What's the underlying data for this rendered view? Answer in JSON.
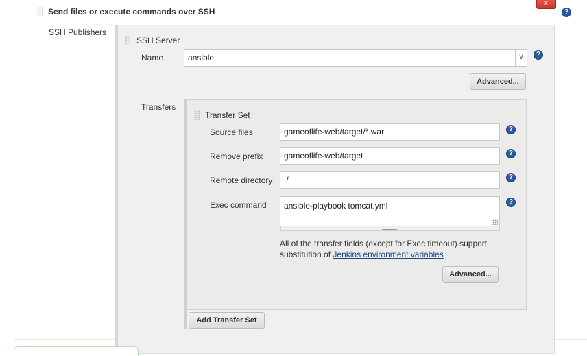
{
  "section": {
    "title": "Send files or execute commands over SSH",
    "delete_label": "X",
    "help_glyph": "?"
  },
  "publishers": {
    "label": "SSH Publishers",
    "server": {
      "title": "SSH Server",
      "name_label": "Name",
      "name_value": "ansible",
      "advanced_label": "Advanced..."
    },
    "transfers": {
      "label": "Transfers",
      "set": {
        "title": "Transfer Set",
        "source_files_label": "Source files",
        "source_files_value": "gameoflife-web/target/*.war",
        "remove_prefix_label": "Remove prefix",
        "remove_prefix_value": "gameoflife-web/target",
        "remote_directory_label": "Remote directory",
        "remote_directory_value": "./",
        "exec_command_label": "Exec command",
        "exec_command_value": "ansible-playbook  tomcat.yml",
        "description_text": "All of the transfer fields (except for Exec timeout) support substitution of ",
        "description_link": "Jenkins environment variables",
        "advanced_label": "Advanced..."
      },
      "add_label": "Add Transfer Set"
    }
  },
  "icons": {
    "help": "help-icon",
    "drag": "drag-handle-icon",
    "dropdown": "chevron-down-icon",
    "resize": "resize-grip-icon"
  },
  "colors": {
    "help_blue": "#2a5a9e",
    "delete_red": "#d2483c",
    "link_blue": "#204a87",
    "panel_bg": "#f0f0f0"
  }
}
